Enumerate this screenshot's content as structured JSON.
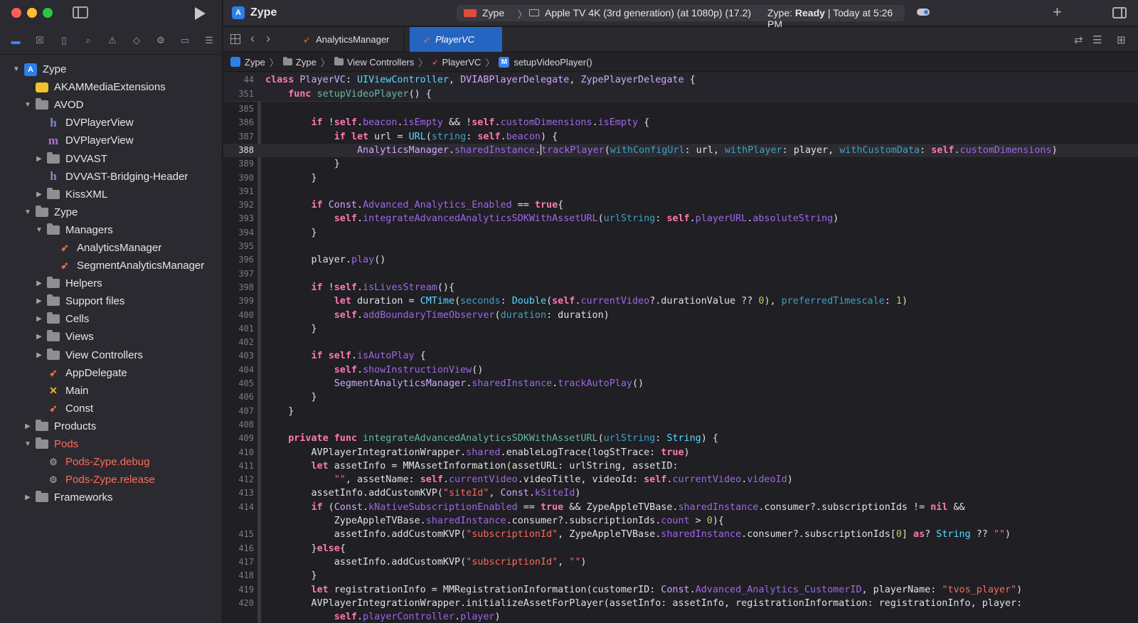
{
  "window": {
    "app_title": "Zype",
    "scheme_name": "Zype",
    "destination": "Apple TV 4K (3rd generation) (at 1080p) (17.2)",
    "status_prefix": "Zype: ",
    "status_state": "Ready",
    "status_suffix": " | Today at 5:26 PM"
  },
  "navigator": {
    "tabs": [
      "folder-icon",
      "source-control-icon",
      "bookmark-icon",
      "search-icon",
      "warning-icon",
      "test-icon",
      "debug-icon",
      "breakpoint-icon",
      "report-icon"
    ],
    "tree": [
      {
        "label": "Zype",
        "indent": 0,
        "chev": "open",
        "icon": "project"
      },
      {
        "label": "AKAMMediaExtensions",
        "indent": 1,
        "chev": "none",
        "icon": "package"
      },
      {
        "label": "AVOD",
        "indent": 1,
        "chev": "open",
        "icon": "folder"
      },
      {
        "label": "DVPlayerView",
        "indent": 2,
        "chev": "none",
        "icon": "h"
      },
      {
        "label": "DVPlayerView",
        "indent": 2,
        "chev": "none",
        "icon": "m"
      },
      {
        "label": "DVVAST",
        "indent": 2,
        "chev": "closed",
        "icon": "folder"
      },
      {
        "label": "DVVAST-Bridging-Header",
        "indent": 2,
        "chev": "none",
        "icon": "h"
      },
      {
        "label": "KissXML",
        "indent": 2,
        "chev": "closed",
        "icon": "folder"
      },
      {
        "label": "Zype",
        "indent": 1,
        "chev": "open",
        "icon": "folder"
      },
      {
        "label": "Managers",
        "indent": 2,
        "chev": "open",
        "icon": "folder"
      },
      {
        "label": "AnalyticsManager",
        "indent": 3,
        "chev": "none",
        "icon": "swift"
      },
      {
        "label": "SegmentAnalyticsManager",
        "indent": 3,
        "chev": "none",
        "icon": "swift"
      },
      {
        "label": "Helpers",
        "indent": 2,
        "chev": "closed",
        "icon": "folder"
      },
      {
        "label": "Support files",
        "indent": 2,
        "chev": "closed",
        "icon": "folder"
      },
      {
        "label": "Cells",
        "indent": 2,
        "chev": "closed",
        "icon": "folder"
      },
      {
        "label": "Views",
        "indent": 2,
        "chev": "closed",
        "icon": "folder"
      },
      {
        "label": "View Controllers",
        "indent": 2,
        "chev": "closed",
        "icon": "folder"
      },
      {
        "label": "AppDelegate",
        "indent": 2,
        "chev": "none",
        "icon": "swift"
      },
      {
        "label": "Main",
        "indent": 2,
        "chev": "none",
        "icon": "xib"
      },
      {
        "label": "Const",
        "indent": 2,
        "chev": "none",
        "icon": "swift"
      },
      {
        "label": "Products",
        "indent": 1,
        "chev": "closed",
        "icon": "folder"
      },
      {
        "label": "Pods",
        "indent": 1,
        "chev": "open",
        "icon": "folder",
        "red": true
      },
      {
        "label": "Pods-Zype.debug",
        "indent": 2,
        "chev": "none",
        "icon": "gear",
        "red": true
      },
      {
        "label": "Pods-Zype.release",
        "indent": 2,
        "chev": "none",
        "icon": "gear",
        "red": true
      },
      {
        "label": "Frameworks",
        "indent": 1,
        "chev": "closed",
        "icon": "folder"
      }
    ]
  },
  "tabs": {
    "tab1": "AnalyticsManager",
    "tab2": "PlayerVC"
  },
  "breadcrumb": {
    "c1": "Zype",
    "c2": "Zype",
    "c3": "View Controllers",
    "c4": "PlayerVC",
    "c5": "setupVideoPlayer()",
    "method_badge": "M"
  },
  "editor": {
    "current_line": 388,
    "lines": [
      {
        "n": "44",
        "sticky": true,
        "html": "<span class='kw'>class</span> <span class='ty'>PlayerVC</span>: <span class='tp'>UIViewController</span>, <span class='ty'>DVIABPlayerDelegate</span>, <span class='ty'>ZypePlayerDelegate</span> {"
      },
      {
        "n": "351",
        "sticky": true,
        "html": "    <span class='kw'>func</span> <span class='fn'>setupVideoPlayer</span>() {"
      },
      {
        "n": "385",
        "html": ""
      },
      {
        "n": "386",
        "html": "        <span class='kw'>if</span> !<span class='kw'>self</span>.<span class='pm'>beacon</span>.<span class='pm'>isEmpty</span> &amp;&amp; !<span class='kw'>self</span>.<span class='pm'>customDimensions</span>.<span class='pm'>isEmpty</span> {"
      },
      {
        "n": "387",
        "html": "            <span class='kw'>if let</span> url = <span class='tp'>URL</span>(<span class='mf'>string</span>: <span class='kw'>self</span>.<span class='pm'>beacon</span>) {"
      },
      {
        "n": "388",
        "html": "                <span class='ty'>AnalyticsManager</span>.<span class='pm'>sharedInstance</span>.<span class='caret'></span><span class='pm'>trackPlayer</span>(<span class='mf'>withConfigUrl</span>: url, <span class='mf'>withPlayer</span>: player, <span class='mf'>withCustomData</span>: <span class='kw'>self</span>.<span class='pm'>customDimensions</span>)"
      },
      {
        "n": "389",
        "html": "            }"
      },
      {
        "n": "390",
        "html": "        }"
      },
      {
        "n": "391",
        "html": ""
      },
      {
        "n": "392",
        "html": "        <span class='kw'>if</span> <span class='ty'>Const</span>.<span class='pm'>Advanced_Analytics_Enabled</span> == <span class='kw'>true</span>{"
      },
      {
        "n": "393",
        "html": "            <span class='kw'>self</span>.<span class='pm'>integrateAdvancedAnalyticsSDKWithAssetURL</span>(<span class='mf'>urlString</span>: <span class='kw'>self</span>.<span class='pm'>playerURL</span>.<span class='pm'>absoluteString</span>)"
      },
      {
        "n": "394",
        "html": "        }"
      },
      {
        "n": "395",
        "html": ""
      },
      {
        "n": "396",
        "html": "        player.<span class='pm'>play</span>()"
      },
      {
        "n": "397",
        "html": ""
      },
      {
        "n": "398",
        "html": "        <span class='kw'>if</span> !<span class='kw'>self</span>.<span class='pm'>isLivesStream</span>(){"
      },
      {
        "n": "399",
        "html": "            <span class='kw'>let</span> duration = <span class='tp'>CMTime</span>(<span class='mf'>seconds</span>: <span class='tp'>Double</span>(<span class='kw'>self</span>.<span class='pm'>currentVideo</span>?.durationValue ?? <span class='num'>0</span>), <span class='mf'>preferredTimescale</span>: <span class='num'>1</span>)"
      },
      {
        "n": "400",
        "html": "            <span class='kw'>self</span>.<span class='pm'>addBoundaryTimeObserver</span>(<span class='mf'>duration</span>: duration)"
      },
      {
        "n": "401",
        "html": "        }"
      },
      {
        "n": "402",
        "html": ""
      },
      {
        "n": "403",
        "html": "        <span class='kw'>if</span> <span class='kw'>self</span>.<span class='pm'>isAutoPlay</span> {"
      },
      {
        "n": "404",
        "html": "            <span class='kw'>self</span>.<span class='pm'>showInstructionView</span>()"
      },
      {
        "n": "405",
        "html": "            <span class='ty'>SegmentAnalyticsManager</span>.<span class='pm'>sharedInstance</span>.<span class='pm'>trackAutoPlay</span>()"
      },
      {
        "n": "406",
        "html": "        }"
      },
      {
        "n": "407",
        "html": "    }"
      },
      {
        "n": "408",
        "html": ""
      },
      {
        "n": "409",
        "html": "    <span class='kw'>private func</span> <span class='fn'>integrateAdvancedAnalyticsSDKWithAssetURL</span>(<span class='mf'>urlString</span>: <span class='tp'>String</span>) {"
      },
      {
        "n": "410",
        "html": "        AVPlayerIntegrationWrapper.<span class='pm'>shared</span>.enableLogTrace(logStTrace: <span class='kw'>true</span>)"
      },
      {
        "n": "411",
        "html": "        <span class='kw'>let</span> assetInfo = MMAssetInformation(assetURL: urlString, assetID:"
      },
      {
        "n": "412",
        "html": "            <span class='str'>\"\"</span>, assetName: <span class='kw'>self</span>.<span class='pm'>currentVideo</span>.videoTitle, videoId: <span class='kw'>self</span>.<span class='pm'>currentVideo</span>.<span class='pm'>videoId</span>)"
      },
      {
        "n": "413",
        "html": "        assetInfo.addCustomKVP(<span class='str'>\"siteId\"</span>, <span class='ty'>Const</span>.<span class='pm'>kSiteId</span>)"
      },
      {
        "n": "414",
        "html": "        <span class='kw'>if</span> (<span class='ty'>Const</span>.<span class='pm'>kNativeSubscriptionEnabled</span> == <span class='kw'>true</span> &amp;&amp; ZypeAppleTVBase.<span class='pm'>sharedInstance</span>.consumer?.subscriptionIds != <span class='kw'>nil</span> &amp;&amp;"
      },
      {
        "n": "",
        "html": "            ZypeAppleTVBase.<span class='pm'>sharedInstance</span>.consumer?.subscriptionIds.<span class='pm'>count</span> &gt; <span class='num'>0</span>){"
      },
      {
        "n": "415",
        "html": "            assetInfo.addCustomKVP(<span class='str'>\"subscriptionId\"</span>, ZypeAppleTVBase.<span class='pm'>sharedInstance</span>.consumer?.subscriptionIds[<span class='num'>0</span>] <span class='kw'>as</span>? <span class='tp'>String</span> ?? <span class='str'>\"\"</span>)"
      },
      {
        "n": "416",
        "html": "        }<span class='kw'>else</span>{"
      },
      {
        "n": "417",
        "html": "            assetInfo.addCustomKVP(<span class='str'>\"subscriptionId\"</span>, <span class='str'>\"\"</span>)"
      },
      {
        "n": "418",
        "html": "        }"
      },
      {
        "n": "419",
        "html": "        <span class='kw'>let</span> registrationInfo = MMRegistrationInformation(customerID: <span class='ty'>Const</span>.<span class='pm'>Advanced_Analytics_CustomerID</span>, playerName: <span class='str'>\"tvos_player\"</span>)"
      },
      {
        "n": "420",
        "html": "        AVPlayerIntegrationWrapper.initializeAssetForPlayer(assetInfo: assetInfo, registrationInformation: registrationInfo, player:"
      },
      {
        "n": "",
        "html": "            <span class='kw'>self</span>.<span class='pm'>playerController</span>.<span class='pm'>player</span>)"
      }
    ]
  }
}
